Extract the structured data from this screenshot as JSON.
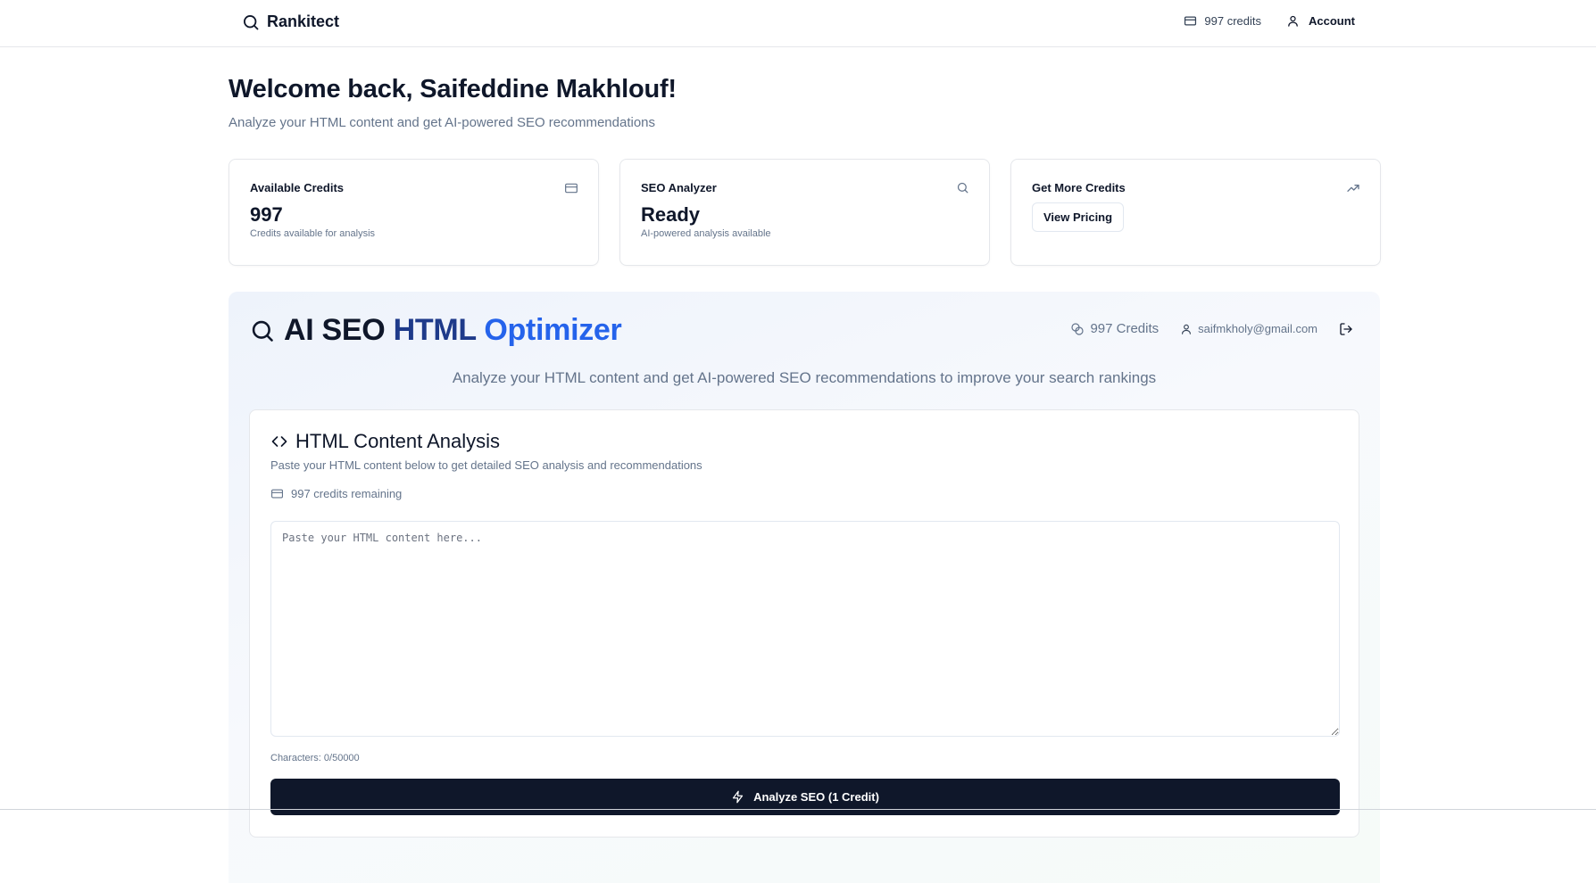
{
  "nav": {
    "brand": "Rankitect",
    "credits_label": "997 credits",
    "account_label": "Account"
  },
  "welcome": {
    "title": "Welcome back, Saifeddine Makhlouf!",
    "subtitle": "Analyze your HTML content and get AI-powered SEO recommendations"
  },
  "cards": [
    {
      "title": "Available Credits",
      "value": "997",
      "sub": "Credits available for analysis",
      "icon": "credit-card-icon"
    },
    {
      "title": "SEO Analyzer",
      "value": "Ready",
      "sub": "AI-powered analysis available",
      "icon": "search-icon"
    },
    {
      "title": "Get More Credits",
      "button": "View Pricing",
      "icon": "trending-up-icon"
    }
  ],
  "optimizer": {
    "title_part1": "AI SEO",
    "title_part2": "HTML",
    "title_part3": "Optimizer",
    "credits": "997 Credits",
    "email": "saifmkholy@gmail.com",
    "description": "Analyze your HTML content and get AI-powered SEO recommendations to improve your search rankings",
    "analysis": {
      "title": "HTML Content Analysis",
      "description": "Paste your HTML content below to get detailed SEO analysis and recommendations",
      "credits_remaining": "997 credits remaining",
      "input_placeholder": "Paste your HTML content here...",
      "input_value": "",
      "char_count": "Characters: 0/50000",
      "analyze_button": "Analyze SEO (1 Credit)"
    }
  },
  "colors": {
    "primary": "#0f172a",
    "accent_blue": "#2563eb",
    "accent_navy": "#1e3a8a",
    "muted": "#64748b"
  }
}
